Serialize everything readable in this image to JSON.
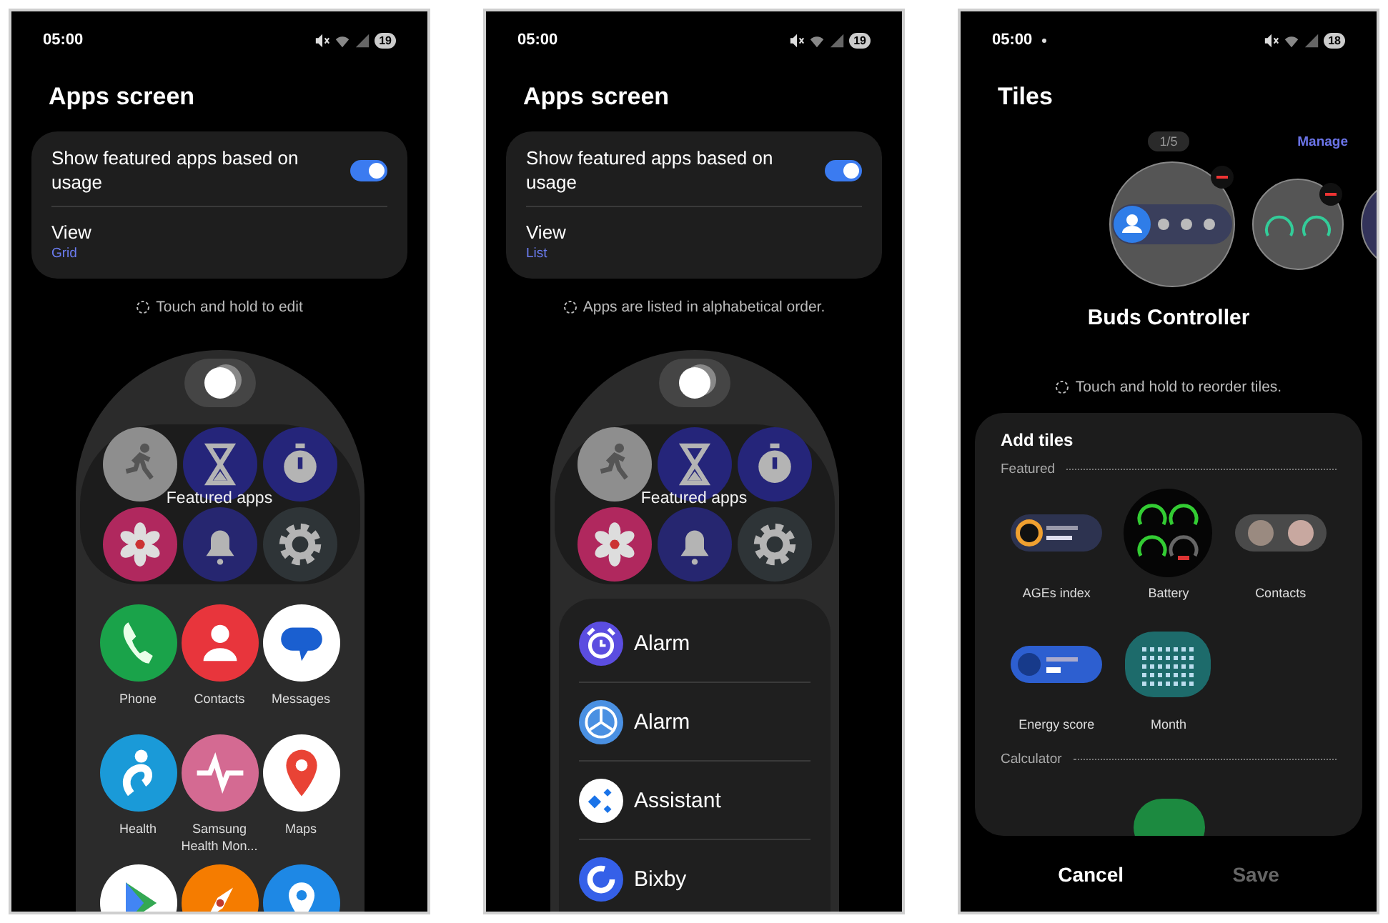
{
  "screens": [
    {
      "kind": "apps_grid",
      "status_bar": {
        "time": "05:00",
        "battery": "19"
      },
      "title": "Apps screen",
      "settings": {
        "toggle_label": "Show featured apps based on usage",
        "toggle_on": true,
        "view_label": "View",
        "view_value": "Grid"
      },
      "hint": "Touch and hold to edit",
      "featured": {
        "label": "Featured apps",
        "icons": [
          {
            "color": "#8e8e8e"
          },
          {
            "color": "#25257a"
          },
          {
            "color": "#25257a"
          },
          {
            "color": "#b0285e"
          },
          {
            "color": "#262670"
          },
          {
            "color": "#2e3437"
          }
        ]
      },
      "apps": [
        {
          "label": "Phone",
          "color": "#1aa34a"
        },
        {
          "label": "Contacts",
          "color": "#e8353c"
        },
        {
          "label": "Messages",
          "color": "#ffffff"
        },
        {
          "label": "Health",
          "color": "#1a9ad8"
        },
        {
          "label": "Samsung Health Mon...",
          "color": "#d46a92"
        },
        {
          "label": "Maps",
          "color": "#ffffff"
        },
        {
          "color": "#ffffff"
        },
        {
          "color": "#f57c00"
        },
        {
          "color": "#1e88e5"
        }
      ]
    },
    {
      "kind": "apps_list",
      "status_bar": {
        "time": "05:00",
        "battery": "19"
      },
      "title": "Apps screen",
      "settings": {
        "toggle_label": "Show featured apps based on usage",
        "toggle_on": true,
        "view_label": "View",
        "view_value": "List"
      },
      "hint": "Apps are listed in alphabetical order.",
      "featured": {
        "label": "Featured apps",
        "icons": [
          {
            "color": "#8e8e8e"
          },
          {
            "color": "#25257a"
          },
          {
            "color": "#25257a"
          },
          {
            "color": "#b0285e"
          },
          {
            "color": "#262670"
          },
          {
            "color": "#2e3437"
          }
        ]
      },
      "apps": [
        {
          "label": "Alarm",
          "color": "#5b4de0"
        },
        {
          "label": "Alarm",
          "color": "#4a90e2"
        },
        {
          "label": "Assistant",
          "color": "#ffffff"
        },
        {
          "label": "Bixby",
          "color": "#3560e8"
        }
      ]
    },
    {
      "kind": "tiles",
      "status_bar": {
        "time": "05:00",
        "notification_dot": true,
        "battery": "18"
      },
      "title": "Tiles",
      "page_indicator": "1/5",
      "manage": "Manage",
      "current_tile": "Buds Controller",
      "hint": "Touch and hold to reorder tiles.",
      "add_tiles": {
        "title": "Add tiles",
        "sections": [
          {
            "label": "Featured",
            "tiles": [
              {
                "label": "AGEs index"
              },
              {
                "label": "Battery"
              },
              {
                "label": "Contacts"
              },
              {
                "label": "Energy score"
              },
              {
                "label": "Month"
              }
            ]
          },
          {
            "label": "Calculator"
          }
        ]
      },
      "buttons": [
        {
          "label": "Cancel",
          "disabled": false
        },
        {
          "label": "Save",
          "disabled": true
        }
      ]
    }
  ]
}
